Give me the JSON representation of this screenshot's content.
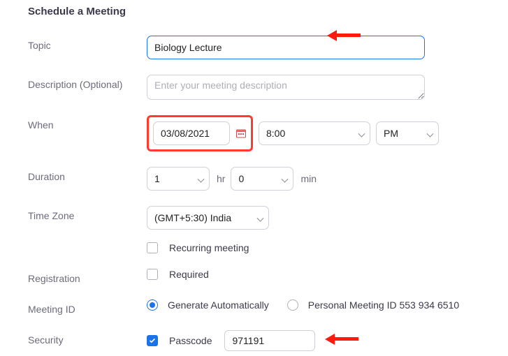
{
  "heading": "Schedule a Meeting",
  "labels": {
    "topic": "Topic",
    "description": "Description (Optional)",
    "when": "When",
    "duration": "Duration",
    "timezone": "Time Zone",
    "registration": "Registration",
    "meeting_id": "Meeting ID",
    "security": "Security"
  },
  "topic": {
    "value": "Biology Lecture"
  },
  "description": {
    "placeholder": "Enter your meeting description",
    "value": ""
  },
  "when": {
    "date": "03/08/2021",
    "time": "8:00",
    "ampm": "PM"
  },
  "duration": {
    "hours": "1",
    "hours_unit": "hr",
    "minutes": "0",
    "minutes_unit": "min"
  },
  "timezone": {
    "value": "(GMT+5:30) India"
  },
  "recurring": {
    "label": "Recurring meeting",
    "checked": false
  },
  "registration": {
    "label": "Required",
    "checked": false
  },
  "meeting_id": {
    "auto_label": "Generate Automatically",
    "personal_label": "Personal Meeting ID 553 934 6510",
    "selected": "auto"
  },
  "security": {
    "passcode_label": "Passcode",
    "passcode_checked": true,
    "passcode_value": "971191"
  }
}
